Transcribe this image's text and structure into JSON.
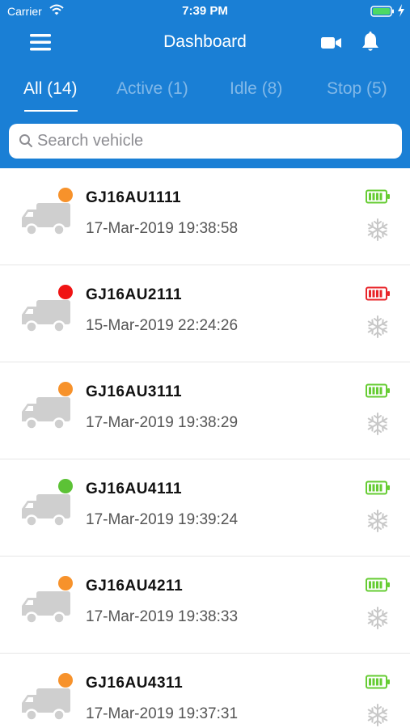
{
  "status_bar": {
    "carrier": "Carrier",
    "time": "7:39 PM"
  },
  "nav": {
    "title": "Dashboard"
  },
  "tabs": [
    {
      "label": "All (14)",
      "active": true
    },
    {
      "label": "Active (1)",
      "active": false
    },
    {
      "label": "Idle (8)",
      "active": false
    },
    {
      "label": "Stop (5)",
      "active": false
    }
  ],
  "search": {
    "placeholder": "Search vehicle",
    "value": ""
  },
  "status_colors": {
    "idle": "#f7922b",
    "stop": "#f01414",
    "active": "#5cc236"
  },
  "battery_colors": {
    "ok": "#66cc33",
    "low": "#e8252a"
  },
  "vehicles": [
    {
      "plate": "GJ16AU1111",
      "timestamp": "17-Mar-2019 19:38:58",
      "status": "idle",
      "battery": "ok",
      "icon": "truck-icon"
    },
    {
      "plate": "GJ16AU2111",
      "timestamp": "15-Mar-2019 22:24:26",
      "status": "stop",
      "battery": "low",
      "icon": "truck-icon"
    },
    {
      "plate": "GJ16AU3111",
      "timestamp": "17-Mar-2019 19:38:29",
      "status": "idle",
      "battery": "ok",
      "icon": "truck-icon"
    },
    {
      "plate": "GJ16AU4111",
      "timestamp": "17-Mar-2019 19:39:24",
      "status": "active",
      "battery": "ok",
      "icon": "truck-icon"
    },
    {
      "plate": "GJ16AU4211",
      "timestamp": "17-Mar-2019 19:38:33",
      "status": "idle",
      "battery": "ok",
      "icon": "truck-icon"
    },
    {
      "plate": "GJ16AU4311",
      "timestamp": "17-Mar-2019 19:37:31",
      "status": "idle",
      "battery": "ok",
      "icon": "truck-icon"
    }
  ]
}
